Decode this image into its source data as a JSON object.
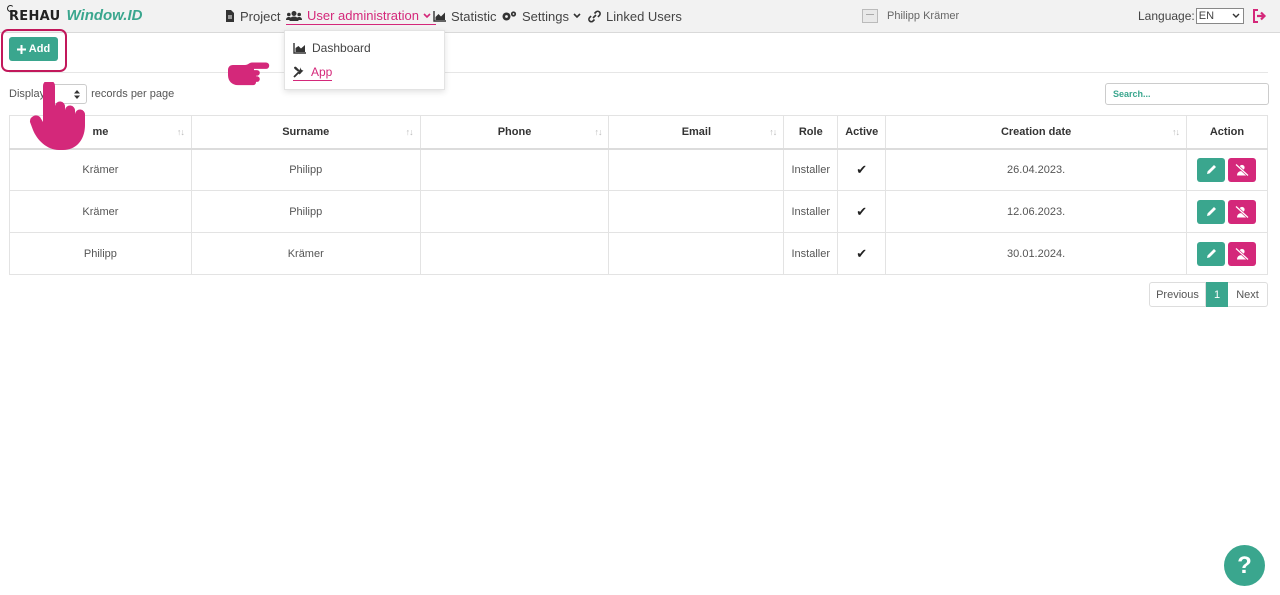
{
  "brand": {
    "name": "REHAU",
    "product": "Window.ID"
  },
  "nav": {
    "project": "Project",
    "user_admin": "User administration",
    "statistic": "Statistic",
    "settings": "Settings",
    "linked_users": "Linked Users"
  },
  "dropdown": {
    "items": [
      "Dashboard",
      "App"
    ],
    "active": "App"
  },
  "user": {
    "name": "Philipp Krämer"
  },
  "language": {
    "label": "Language:",
    "value": "EN"
  },
  "toolbar": {
    "add_label": "Add"
  },
  "display": {
    "prefix": "Display",
    "suffix": "records per page"
  },
  "search": {
    "placeholder": "Search..."
  },
  "table": {
    "headers": [
      "me",
      "Surname",
      "Phone",
      "Email",
      "Role",
      "Active",
      "Creation date",
      "Action"
    ],
    "rows": [
      {
        "name": "Krämer",
        "surname": "Philipp",
        "phone": "",
        "email": "",
        "role": "Installer",
        "active": "✔",
        "created": "26.04.2023."
      },
      {
        "name": "Krämer",
        "surname": "Philipp",
        "phone": "",
        "email": "",
        "role": "Installer",
        "active": "✔",
        "created": "12.06.2023."
      },
      {
        "name": "Philipp",
        "surname": "Krämer",
        "phone": "",
        "email": "",
        "role": "Installer",
        "active": "✔",
        "created": "30.01.2024."
      }
    ]
  },
  "pagination": {
    "previous": "Previous",
    "current": "1",
    "next": "Next"
  },
  "help": {
    "label": "?"
  },
  "colors": {
    "accent": "#3aa68e",
    "brand_pink": "#d4287a"
  }
}
